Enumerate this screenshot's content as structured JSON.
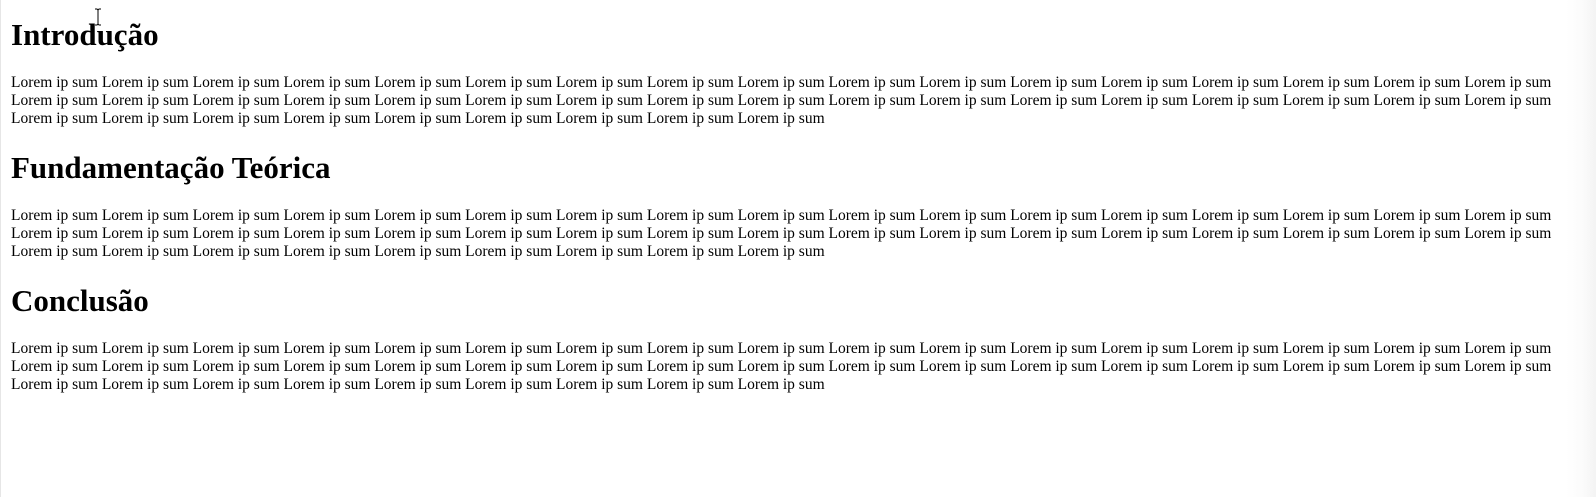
{
  "sections": [
    {
      "heading": "Introdução",
      "body": "Lorem ip sum Lorem ip sum Lorem ip sum Lorem ip sum Lorem ip sum Lorem ip sum Lorem ip sum Lorem ip sum Lorem ip sum Lorem ip sum Lorem ip sum Lorem ip sum Lorem ip sum Lorem ip sum Lorem ip sum Lorem ip sum Lorem ip sum Lorem ip sum Lorem ip sum Lorem ip sum Lorem ip sum Lorem ip sum Lorem ip sum Lorem ip sum Lorem ip sum Lorem ip sum Lorem ip sum Lorem ip sum Lorem ip sum Lorem ip sum Lorem ip sum Lorem ip sum Lorem ip sum Lorem ip sum Lorem ip sum Lorem ip sum Lorem ip sum Lorem ip sum Lorem ip sum Lorem ip sum Lorem ip sum Lorem ip sum Lorem ip sum"
    },
    {
      "heading": "Fundamentação Teórica",
      "body": "Lorem ip sum Lorem ip sum Lorem ip sum Lorem ip sum Lorem ip sum Lorem ip sum Lorem ip sum Lorem ip sum Lorem ip sum Lorem ip sum Lorem ip sum Lorem ip sum Lorem ip sum Lorem ip sum Lorem ip sum Lorem ip sum Lorem ip sum Lorem ip sum Lorem ip sum Lorem ip sum Lorem ip sum Lorem ip sum Lorem ip sum Lorem ip sum Lorem ip sum Lorem ip sum Lorem ip sum Lorem ip sum Lorem ip sum Lorem ip sum Lorem ip sum Lorem ip sum Lorem ip sum Lorem ip sum Lorem ip sum Lorem ip sum Lorem ip sum Lorem ip sum Lorem ip sum Lorem ip sum Lorem ip sum Lorem ip sum Lorem ip sum"
    },
    {
      "heading": "Conclusão",
      "body": "Lorem ip sum Lorem ip sum Lorem ip sum Lorem ip sum Lorem ip sum Lorem ip sum Lorem ip sum Lorem ip sum Lorem ip sum Lorem ip sum Lorem ip sum Lorem ip sum Lorem ip sum Lorem ip sum Lorem ip sum Lorem ip sum Lorem ip sum Lorem ip sum Lorem ip sum Lorem ip sum Lorem ip sum Lorem ip sum Lorem ip sum Lorem ip sum Lorem ip sum Lorem ip sum Lorem ip sum Lorem ip sum Lorem ip sum Lorem ip sum Lorem ip sum Lorem ip sum Lorem ip sum Lorem ip sum Lorem ip sum Lorem ip sum Lorem ip sum Lorem ip sum Lorem ip sum Lorem ip sum Lorem ip sum Lorem ip sum Lorem ip sum"
    }
  ],
  "cursor": {
    "icon": "text-cursor-icon"
  },
  "colors": {
    "background": "#ffffff",
    "text": "#000000"
  }
}
